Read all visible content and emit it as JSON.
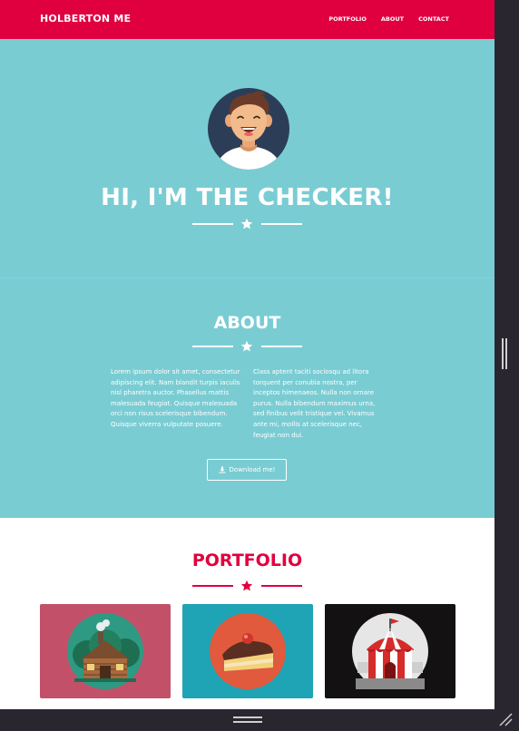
{
  "navbar": {
    "brand": "HOLBERTON ME",
    "links": [
      "PORTFOLIO",
      "ABOUT",
      "CONTACT"
    ],
    "color": "#e1003f"
  },
  "hero": {
    "title": "HI, I'M THE CHECKER!",
    "background": "#7accd3",
    "avatar_icon": "avatar-icon"
  },
  "about": {
    "title": "ABOUT",
    "col1": "Lorem ipsum dolor sit amet, consectetur adipiscing elit. Nam blandit turpis iaculis nisl pharetra auctor. Phasellus mattis malesuada feugiat. Quisque malesuada orci non risus scelerisque bibendum. Quisque viverra vulputate posuere.",
    "col2": "Class aptent taciti sociosqu ad litora torquent per conubia nostra, per inceptos himenaeos. Nulla non ornare purus. Nulla bibendum maximus urna, sed finibus velit tristique vel. Vivamus ante mi, mollis at scelerisque nec, feugiat non dui.",
    "download_label": "Download me!",
    "download_icon": "download-icon"
  },
  "portfolio": {
    "title": "PORTFOLIO",
    "accent": "#e1003f",
    "cards": [
      {
        "icon": "cabin-icon",
        "bg": "#c25069"
      },
      {
        "icon": "cake-icon",
        "bg": "#1ea4b5"
      },
      {
        "icon": "circus-tent-icon",
        "bg": "#131111"
      }
    ]
  }
}
